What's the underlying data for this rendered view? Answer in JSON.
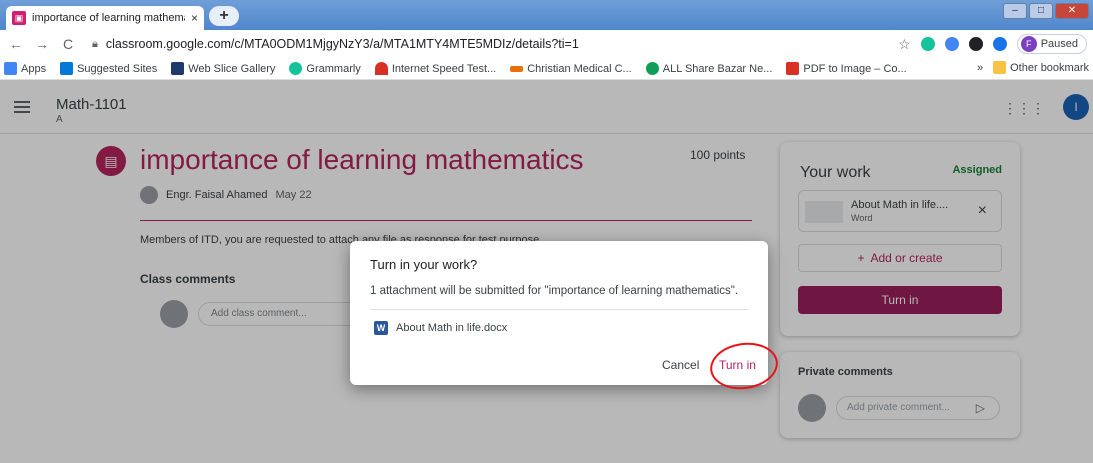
{
  "browser": {
    "tab_title": "importance of learning mathema",
    "tab_close": "×",
    "new_tab": "+",
    "url": "classroom.google.com/c/MTA0ODM1MjgyNzY3/a/MTA1MTY4MTE5MDIz/details?ti=1",
    "profile_initial": "F",
    "profile_status": "Paused",
    "back": "←",
    "forward": "→",
    "reload": "C",
    "star": "☆"
  },
  "bookmarks": {
    "items": [
      {
        "label": "Apps",
        "color": "#4285f4"
      },
      {
        "label": "Suggested Sites",
        "color": "#0078d7"
      },
      {
        "label": "Web Slice Gallery",
        "color": "#1e3a6a"
      },
      {
        "label": "Grammarly",
        "color": "#15c39a"
      },
      {
        "label": "Internet Speed Test...",
        "color": "#d93025"
      },
      {
        "label": "Christian Medical C...",
        "color": "#e8710a"
      },
      {
        "label": "ALL Share Bazar Ne...",
        "color": "#0f9d58"
      },
      {
        "label": "PDF to Image – Co...",
        "color": "#d93025"
      }
    ],
    "more": "»",
    "other": "Other bookmark"
  },
  "classroom": {
    "class_name": "Math-1101",
    "class_section": "A",
    "user_initial": "I",
    "apps_icon": "⋮⋮⋮"
  },
  "assignment": {
    "title": "importance of learning mathematics",
    "points": "100 points",
    "author": "Engr. Faisal Ahamed",
    "date": "May 22",
    "description": "Members of ITD, you are requested to attach any file as response for test purpose.",
    "class_comments_title": "Class comments",
    "class_comment_placeholder": "Add class comment..."
  },
  "your_work": {
    "title": "Your work",
    "status": "Assigned",
    "attachment_name": "About Math in life....",
    "attachment_type": "Word",
    "remove": "×",
    "add_create": "Add or create",
    "add_plus": "+",
    "turn_in": "Turn in"
  },
  "private_comments": {
    "title": "Private comments",
    "placeholder": "Add private comment...",
    "send": "▷"
  },
  "dialog": {
    "title": "Turn in your work?",
    "body": "1 attachment will be submitted for \"importance of learning mathematics\".",
    "file_icon": "W",
    "file_name": "About Math in life.docx",
    "cancel": "Cancel",
    "turn_in": "Turn in"
  },
  "colors": {
    "accent": "#b4245e",
    "assigned": "#188038",
    "annotation": "#e8141b"
  }
}
